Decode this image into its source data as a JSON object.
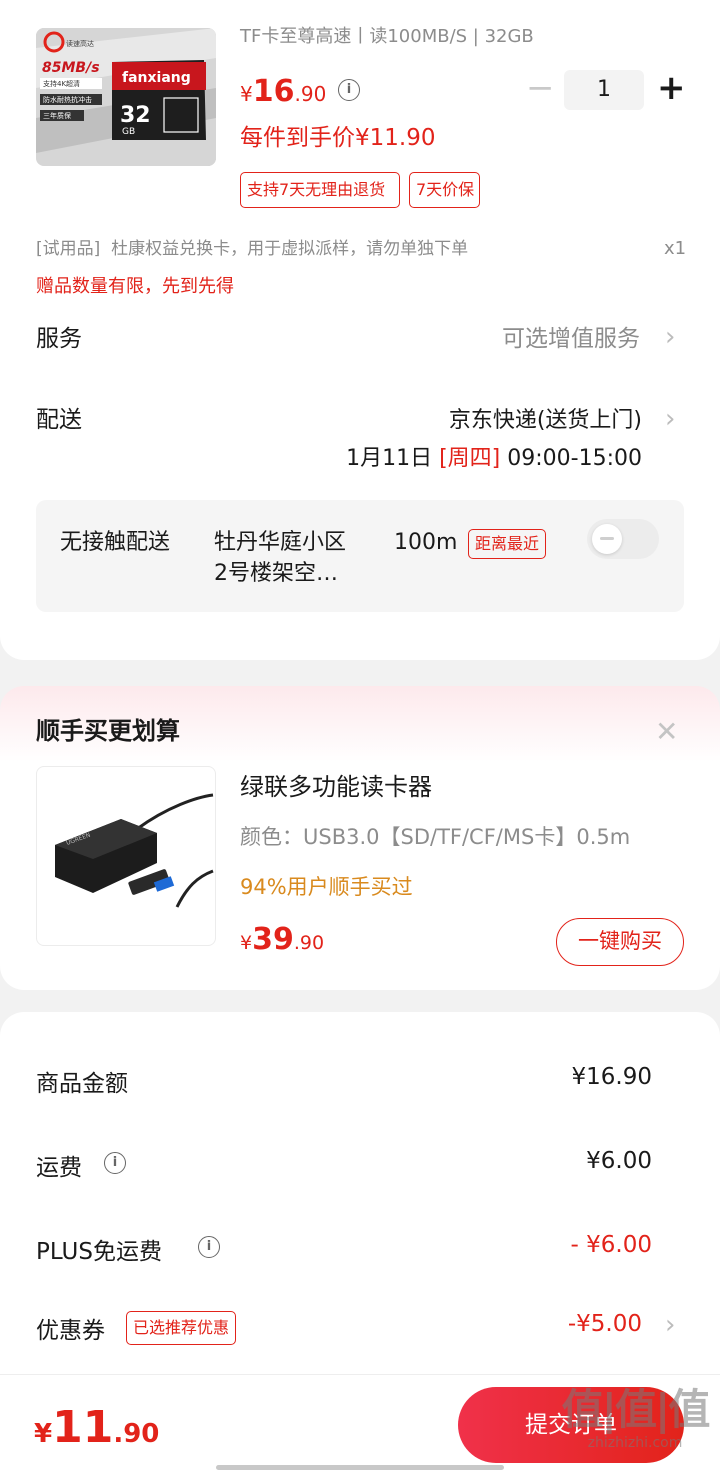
{
  "product": {
    "spec_line": "TF卡至尊高速丨读100MB/S | 32GB",
    "price_symbol": "¥",
    "price_int": "16",
    "price_dec": ".90",
    "final_price_label": "每件到手价¥11.90",
    "tags": [
      "支持7天无理由退货",
      "7天价保"
    ],
    "quantity": "1",
    "card_image": {
      "brand": "fanxiang",
      "speed": "85MB/s",
      "capacity": "32",
      "unit": "GB",
      "badge_lines": [
        "读速高达",
        "支持4K超清",
        "防水耐热抗冲击",
        "三年质保"
      ]
    }
  },
  "gift": {
    "prefix": "[试用品]",
    "text": "杜康权益兑换卡，用于虚拟派样，请勿单独下单",
    "count": "x1",
    "notice": "赠品数量有限，先到先得"
  },
  "service": {
    "label": "服务",
    "value": "可选增值服务"
  },
  "delivery": {
    "label": "配送",
    "method": "京东快递(送货上门)",
    "date": "1月11日",
    "weekday": "[周四]",
    "time": "09:00-15:00"
  },
  "contactless": {
    "label": "无接触配送",
    "place_line1": "牡丹华庭小区",
    "place_line2": "2号楼架空…",
    "distance": "100m",
    "badge": "距离最近",
    "enabled": false
  },
  "recommend": {
    "title": "顺手买更划算",
    "close_glyph": "✕",
    "item": {
      "name": "绿联多功能读卡器",
      "spec": "颜色：USB3.0【SD/TF/CF/MS卡】0.5m",
      "social_proof": "94%用户顺手买过",
      "price_symbol": "¥",
      "price_int": "39",
      "price_dec": ".90",
      "buy_label": "一键购买",
      "image_text": "UGREEN"
    }
  },
  "summary": {
    "goods_label": "商品金额",
    "goods_value": "¥16.90",
    "shipping_label": "运费",
    "shipping_value": "¥6.00",
    "plus_label": "PLUS免运费",
    "plus_value": "- ¥6.00",
    "coupon_label": "优惠券",
    "coupon_tag": "已选推荐优惠",
    "coupon_value": "-¥5.00"
  },
  "bottom": {
    "price_symbol": "¥",
    "price_int": "11",
    "price_dec": ".90",
    "submit_label": "提交订单"
  },
  "watermark": {
    "logo": "值|值|值",
    "site": "zhizhizhi.com"
  },
  "colors": {
    "accent": "#e2231a",
    "panel": "#f5f5f5"
  }
}
